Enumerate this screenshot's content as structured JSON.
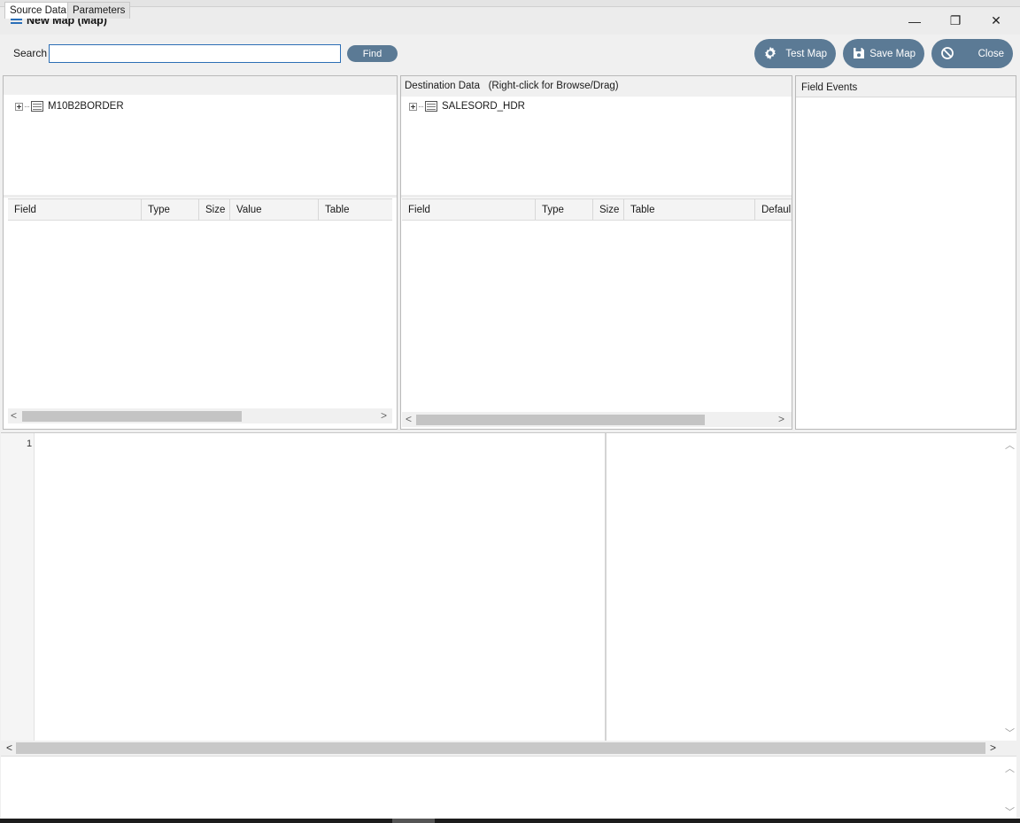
{
  "window": {
    "title": "New Map (Map)",
    "minimize_glyph": "—",
    "maximize_glyph": "❐",
    "close_glyph": "✕"
  },
  "toolbar": {
    "search_label": "Search",
    "search_value": "",
    "find_label": "Find",
    "test_map_label": "Test Map",
    "save_map_label": "Save Map",
    "close_label": "Close",
    "accent_color": "#5b7a95",
    "icons": [
      "gear-icon",
      "save-icon",
      "cancel-icon"
    ]
  },
  "source": {
    "tabs": [
      "Source Data",
      "Parameters"
    ],
    "tree_items": [
      "M10B2BORDER"
    ],
    "columns": [
      "Field",
      "Type",
      "Size",
      "Value",
      "Table"
    ]
  },
  "destination": {
    "header": "Destination Data   (Right-click for Browse/Drag)",
    "tree_items": [
      "SALESORD_HDR"
    ],
    "columns": [
      "Field",
      "Type",
      "Size",
      "Table",
      "Defaul"
    ]
  },
  "events": {
    "header": "Field Events"
  },
  "editor": {
    "line_number": "1"
  }
}
